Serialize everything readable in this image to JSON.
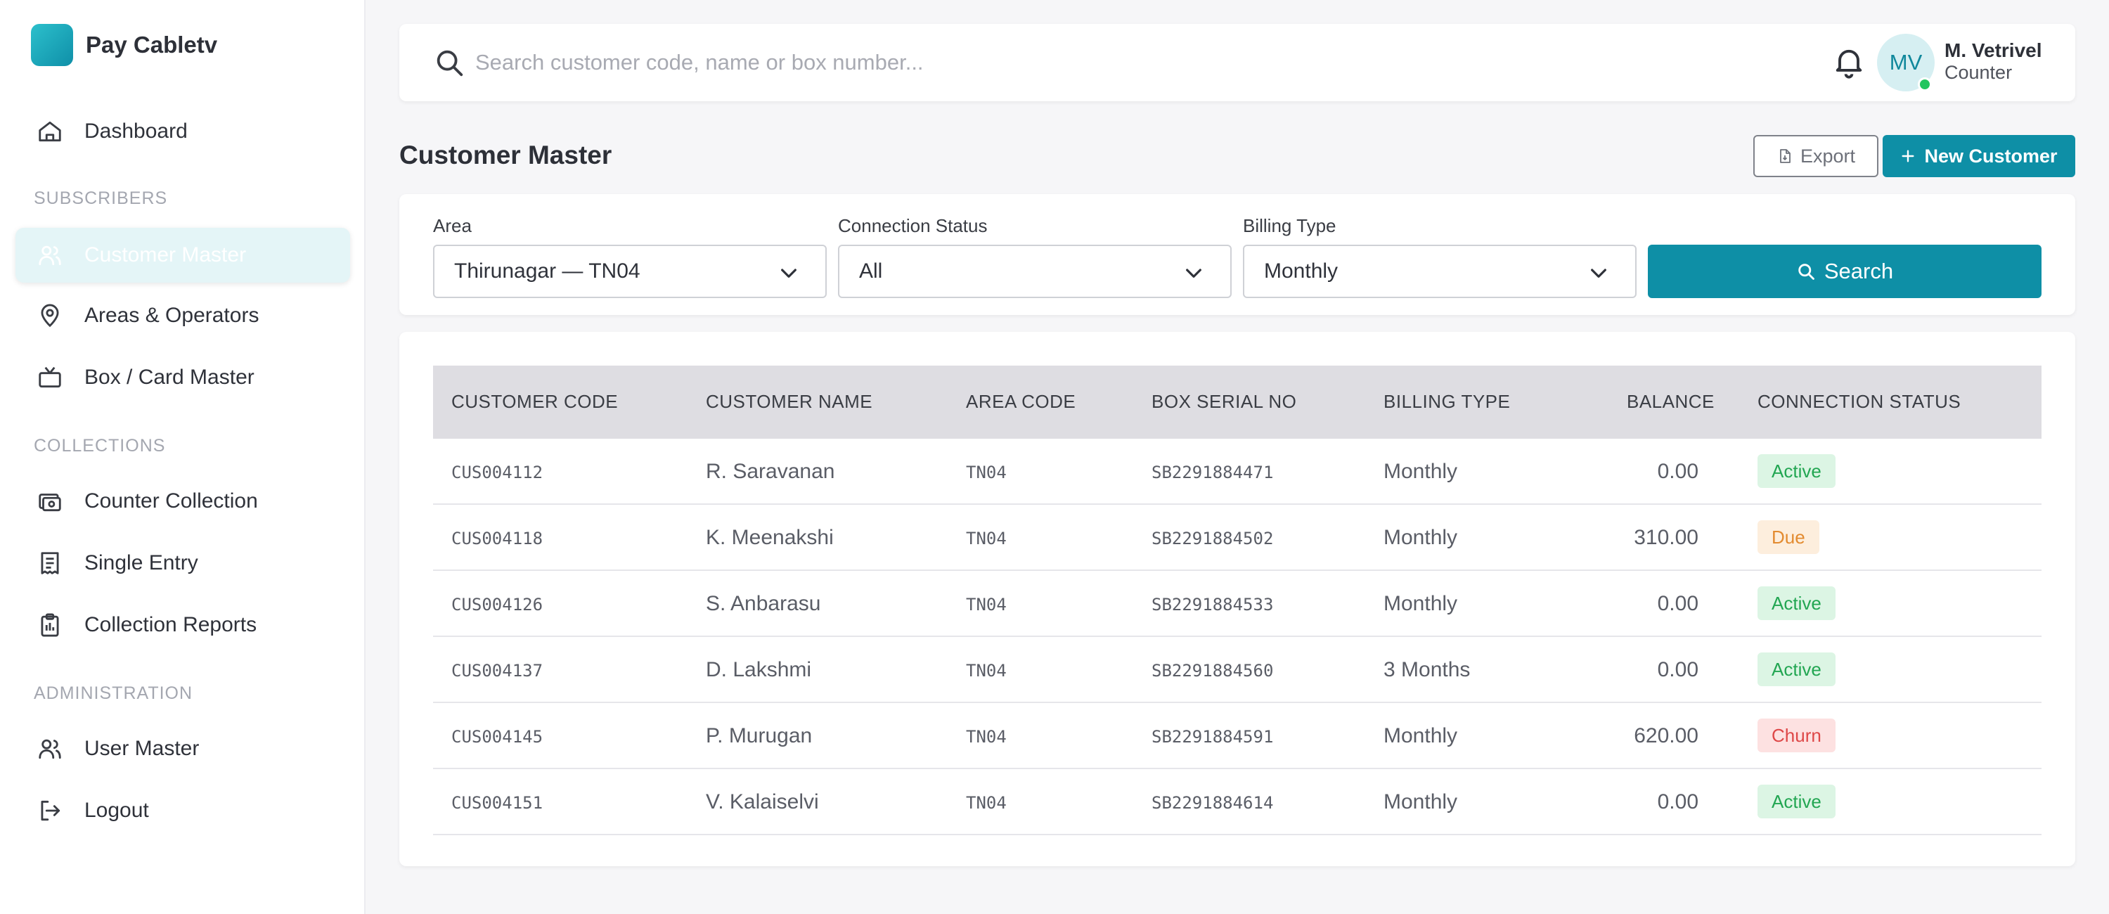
{
  "brand": {
    "name": "Pay Cabletv"
  },
  "sidebar": {
    "dashboard": "Dashboard",
    "section_subscribers": "SUBSCRIBERS",
    "customer_master": "Customer Master",
    "areas_operators": "Areas & Operators",
    "box_card_master": "Box / Card Master",
    "section_collections": "COLLECTIONS",
    "counter_collection": "Counter Collection",
    "single_entry": "Single Entry",
    "collection_reports": "Collection Reports",
    "section_administration": "ADMINISTRATION",
    "user_master": "User Master",
    "logout": "Logout"
  },
  "topbar": {
    "search_placeholder": "Search customer code, name or box number...",
    "user_initials": "MV",
    "user_name": "M. Vetrivel",
    "user_role": "Counter"
  },
  "page": {
    "title": "Customer Master",
    "export_label": "Export",
    "new_customer_label": "New Customer"
  },
  "filters": {
    "area_label": "Area",
    "area_value": "Thirunagar — TN04",
    "status_label": "Connection Status",
    "status_value": "All",
    "billing_label": "Billing Type",
    "billing_value": "Monthly",
    "search_label": "Search"
  },
  "table": {
    "headers": {
      "code": "CUSTOMER CODE",
      "name": "CUSTOMER NAME",
      "area": "AREA CODE",
      "box": "BOX SERIAL NO",
      "billing": "BILLING TYPE",
      "balance": "BALANCE",
      "status": "CONNECTION STATUS"
    },
    "rows": [
      {
        "code": "CUS004112",
        "name": "R. Saravanan",
        "area": "TN04",
        "box": "SB2291884471",
        "billing": "Monthly",
        "balance": "0.00",
        "status": "Active"
      },
      {
        "code": "CUS004118",
        "name": "K. Meenakshi",
        "area": "TN04",
        "box": "SB2291884502",
        "billing": "Monthly",
        "balance": "310.00",
        "status": "Due"
      },
      {
        "code": "CUS004126",
        "name": "S. Anbarasu",
        "area": "TN04",
        "box": "SB2291884533",
        "billing": "Monthly",
        "balance": "0.00",
        "status": "Active"
      },
      {
        "code": "CUS004137",
        "name": "D. Lakshmi",
        "area": "TN04",
        "box": "SB2291884560",
        "billing": "3 Months",
        "balance": "0.00",
        "status": "Active"
      },
      {
        "code": "CUS004145",
        "name": "P. Murugan",
        "area": "TN04",
        "box": "SB2291884591",
        "billing": "Monthly",
        "balance": "620.00",
        "status": "Churn"
      },
      {
        "code": "CUS004151",
        "name": "V. Kalaiselvi",
        "area": "TN04",
        "box": "SB2291884614",
        "billing": "Monthly",
        "balance": "0.00",
        "status": "Active"
      }
    ]
  },
  "colors": {
    "accent": "#0e8fa6",
    "active_badge": "#22a652",
    "due_badge": "#e38b30",
    "churn_badge": "#de4848"
  },
  "icons": {
    "dashboard": "home-icon",
    "customer_master": "users-icon",
    "areas": "map-pin-icon",
    "box_card": "tv-icon",
    "counter_collection": "cash-register-icon",
    "single_entry": "receipt-icon",
    "collection_reports": "clipboard-icon",
    "user_master": "users-icon",
    "logout": "logout-icon",
    "search": "search-icon",
    "notifications": "bell-icon",
    "export": "file-icon",
    "new_customer": "plus-icon",
    "dropdown": "chevron-down-icon"
  }
}
